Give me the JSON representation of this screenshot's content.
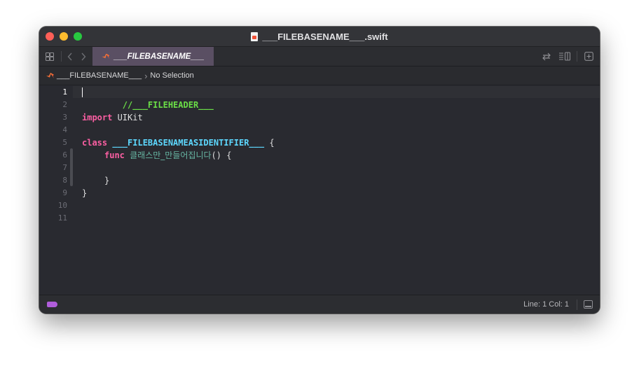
{
  "window": {
    "title": "___FILEBASENAME___.swift"
  },
  "tabbar": {
    "tab_label": "___FILEBASENAME___",
    "icons": [
      "grid-icon",
      "back-chevron-icon",
      "forward-chevron-icon",
      "swap-icon",
      "editor-options-icon",
      "add-editor-icon"
    ]
  },
  "jumpbar": {
    "file": "___FILEBASENAME___",
    "selection": "No Selection"
  },
  "editor": {
    "line_numbers": [
      "1",
      "2",
      "3",
      "4",
      "5",
      "6",
      "7",
      "8",
      "9",
      "10",
      "11"
    ],
    "current_line": "1",
    "line1_comment": "//___FILEHEADER___",
    "line3_keyword": "import",
    "line3_module": " UIKit",
    "line5_keyword": "class",
    "line5_ident": "___FILEBASENAMEASIDENTIFIER___",
    "line5_brace": " {",
    "line6_keyword": "func",
    "line6_name": "클래스만_만들어집니다",
    "line6_rest": "() {",
    "line8_brace": "}",
    "line9_brace": "}"
  },
  "statusbar": {
    "position": "Line: 1  Col: 1"
  },
  "colors": {
    "keyword": "#fc5fa3",
    "comment": "#6bdf47",
    "identifier": "#5dd8ff",
    "function": "#67b7a4",
    "tab_active": "#5a4f63",
    "status_pill": "#b05ddb"
  }
}
